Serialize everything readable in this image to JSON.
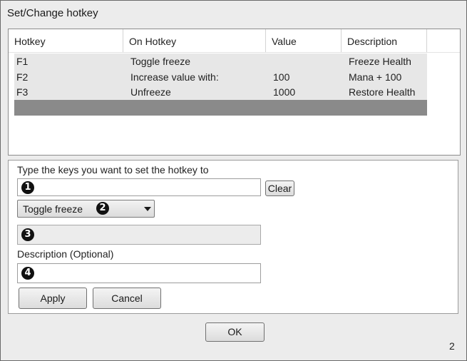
{
  "window": {
    "title": "Set/Change hotkey"
  },
  "list": {
    "columns": [
      "Hotkey",
      "On Hotkey",
      "Value",
      "Description"
    ],
    "rows": [
      {
        "hotkey": "F1",
        "on_hotkey": "Toggle freeze",
        "value": "",
        "description": "Freeze Health"
      },
      {
        "hotkey": "F2",
        "on_hotkey": "Increase value with:",
        "value": "100",
        "description": "Mana + 100"
      },
      {
        "hotkey": "F3",
        "on_hotkey": "Unfreeze",
        "value": "1000",
        "description": "Restore Health"
      }
    ]
  },
  "editor": {
    "prompt_label": "Type the keys you want to set the hotkey to",
    "keys_value": "",
    "clear_label": "Clear",
    "action_selected": "Toggle freeze",
    "value_field": "",
    "description_label": "Description (Optional)",
    "description_value": "",
    "apply_label": "Apply",
    "cancel_label": "Cancel"
  },
  "callouts": [
    "1",
    "2",
    "3",
    "4"
  ],
  "footer": {
    "ok_label": "OK",
    "page_number": "2"
  },
  "icons": {
    "callout_1": "numbered-callout-icon",
    "callout_2": "numbered-callout-icon",
    "callout_3": "numbered-callout-icon",
    "callout_4": "numbered-callout-icon",
    "dropdown_arrow": "chevron-down-icon"
  },
  "colors": {
    "selected_row": "#8a8a8a",
    "row_background": "#e7e7e7",
    "window_background": "#ececec"
  }
}
